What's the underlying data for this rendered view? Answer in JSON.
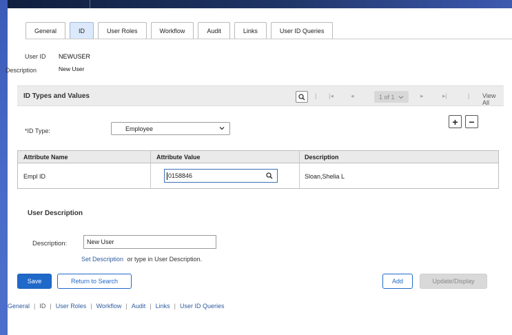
{
  "tabs": [
    {
      "label": "General",
      "active": false
    },
    {
      "label": "ID",
      "active": true
    },
    {
      "label": "User Roles",
      "active": false
    },
    {
      "label": "Workflow",
      "active": false
    },
    {
      "label": "Audit",
      "active": false
    },
    {
      "label": "Links",
      "active": false
    },
    {
      "label": "User ID Queries",
      "active": false
    }
  ],
  "header": {
    "user_id_label": "User ID",
    "user_id_value": "NEWUSER",
    "description_label": "Description",
    "description_value": "New User"
  },
  "id_types": {
    "title": "ID Types and Values",
    "pagination": "1 of 1",
    "view_all": "View All",
    "id_type_label": "*ID Type:",
    "id_type_value": "Employee",
    "add_symbol": "+",
    "remove_symbol": "−"
  },
  "grid": {
    "headers": [
      "Attribute Name",
      "Attribute Value",
      "Description"
    ],
    "row": {
      "attribute_name": "Empl ID",
      "attribute_value": "0158846",
      "description": "Sloan,Shelia L"
    }
  },
  "user_description": {
    "title": "User Description",
    "label": "Description:",
    "value": "New User",
    "set_link": "Set Description",
    "hint": "or type in User Description."
  },
  "buttons": {
    "save": "Save",
    "return": "Return to Search",
    "add": "Add",
    "update": "Update/Display"
  },
  "footer_links": [
    "General",
    "ID",
    "User Roles",
    "Workflow",
    "Audit",
    "Links",
    "User ID Queries"
  ],
  "colors": {
    "primary": "#1f69c9",
    "active_tab": "#dbe9fb",
    "link": "#2f5c9e"
  }
}
